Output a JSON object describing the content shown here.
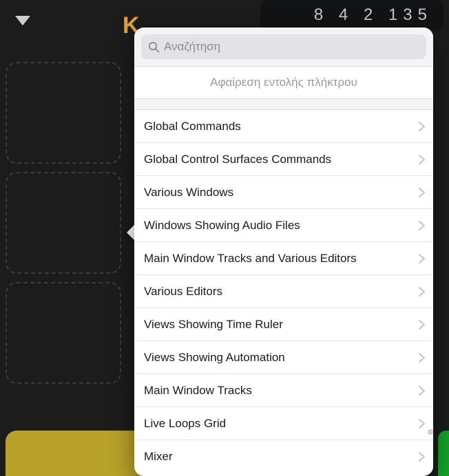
{
  "header": {
    "brand_letter": "K",
    "counter": "8 4 2 135"
  },
  "popover": {
    "search_placeholder": "Αναζήτηση",
    "remove_action": "Αφαίρεση εντολής πλήκτρου",
    "items": [
      {
        "label": "Global Commands"
      },
      {
        "label": "Global Control Surfaces Commands"
      },
      {
        "label": "Various Windows"
      },
      {
        "label": "Windows Showing Audio Files"
      },
      {
        "label": "Main Window Tracks and Various Editors"
      },
      {
        "label": "Various Editors"
      },
      {
        "label": "Views Showing Time Ruler"
      },
      {
        "label": "Views Showing Automation"
      },
      {
        "label": "Main Window Tracks"
      },
      {
        "label": "Live Loops Grid"
      },
      {
        "label": "Mixer"
      }
    ]
  }
}
